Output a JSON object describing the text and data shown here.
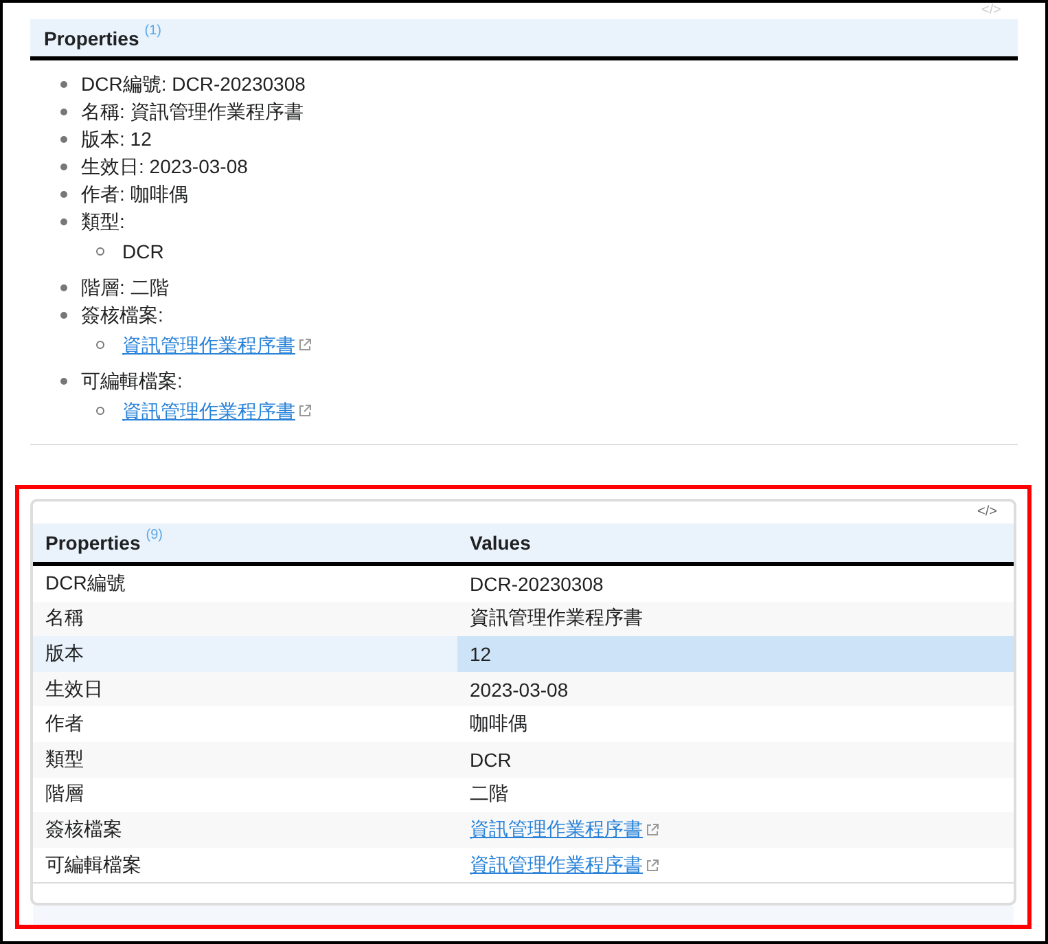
{
  "list_section": {
    "code_toggle": "</>",
    "header": {
      "title": "Properties",
      "count": "(1)"
    },
    "items": [
      {
        "text": "DCR編號: DCR-20230308"
      },
      {
        "text": "名稱: 資訊管理作業程序書"
      },
      {
        "text": "版本: 12"
      },
      {
        "text": "生效日: 2023-03-08"
      },
      {
        "text": "作者: 咖啡偶"
      },
      {
        "text": "類型:",
        "children": [
          {
            "kind": "text",
            "text": "DCR"
          }
        ]
      },
      {
        "text": "階層: 二階"
      },
      {
        "text": "簽核檔案:",
        "children": [
          {
            "kind": "link",
            "text": "資訊管理作業程序書"
          }
        ]
      },
      {
        "text": "可編輯檔案:",
        "children": [
          {
            "kind": "link",
            "text": "資訊管理作業程序書"
          }
        ]
      }
    ]
  },
  "table_section": {
    "code_toggle": "</>",
    "columns": [
      {
        "title": "Properties",
        "count": "(9)"
      },
      {
        "title": "Values"
      }
    ],
    "rows": [
      {
        "property": "DCR編號",
        "value": "DCR-20230308",
        "kind": "text",
        "selected": false
      },
      {
        "property": "名稱",
        "value": "資訊管理作業程序書",
        "kind": "text",
        "selected": false
      },
      {
        "property": "版本",
        "value": "12",
        "kind": "text",
        "selected": true
      },
      {
        "property": "生效日",
        "value": "2023-03-08",
        "kind": "text",
        "selected": false
      },
      {
        "property": "作者",
        "value": "咖啡偶",
        "kind": "text",
        "selected": false
      },
      {
        "property": "類型",
        "value": "DCR",
        "kind": "text",
        "selected": false
      },
      {
        "property": "階層",
        "value": "二階",
        "kind": "text",
        "selected": false
      },
      {
        "property": "簽核檔案",
        "value": "資訊管理作業程序書",
        "kind": "link",
        "selected": false
      },
      {
        "property": "可編輯檔案",
        "value": "資訊管理作業程序書",
        "kind": "link",
        "selected": false
      }
    ]
  }
}
